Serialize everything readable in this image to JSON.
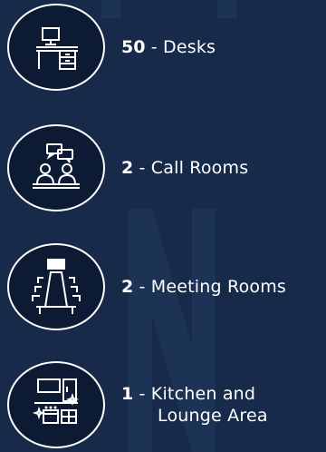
{
  "theme": {
    "background": "#172a4a",
    "circle_fill": "#0c1b33",
    "accent": "#ffffff"
  },
  "amenities": [
    {
      "icon": "desk-icon",
      "count": "50",
      "separator": " - ",
      "label": "Desks",
      "label_line2": ""
    },
    {
      "icon": "call-room-icon",
      "count": "2",
      "separator": " - ",
      "label": "Call Rooms",
      "label_line2": ""
    },
    {
      "icon": "meeting-room-icon",
      "count": "2",
      "separator": " - ",
      "label": "Meeting Rooms",
      "label_line2": ""
    },
    {
      "icon": "kitchen-icon",
      "count": "1",
      "separator": " - ",
      "label": "Kitchen and",
      "label_line2": "Lounge Area"
    }
  ]
}
